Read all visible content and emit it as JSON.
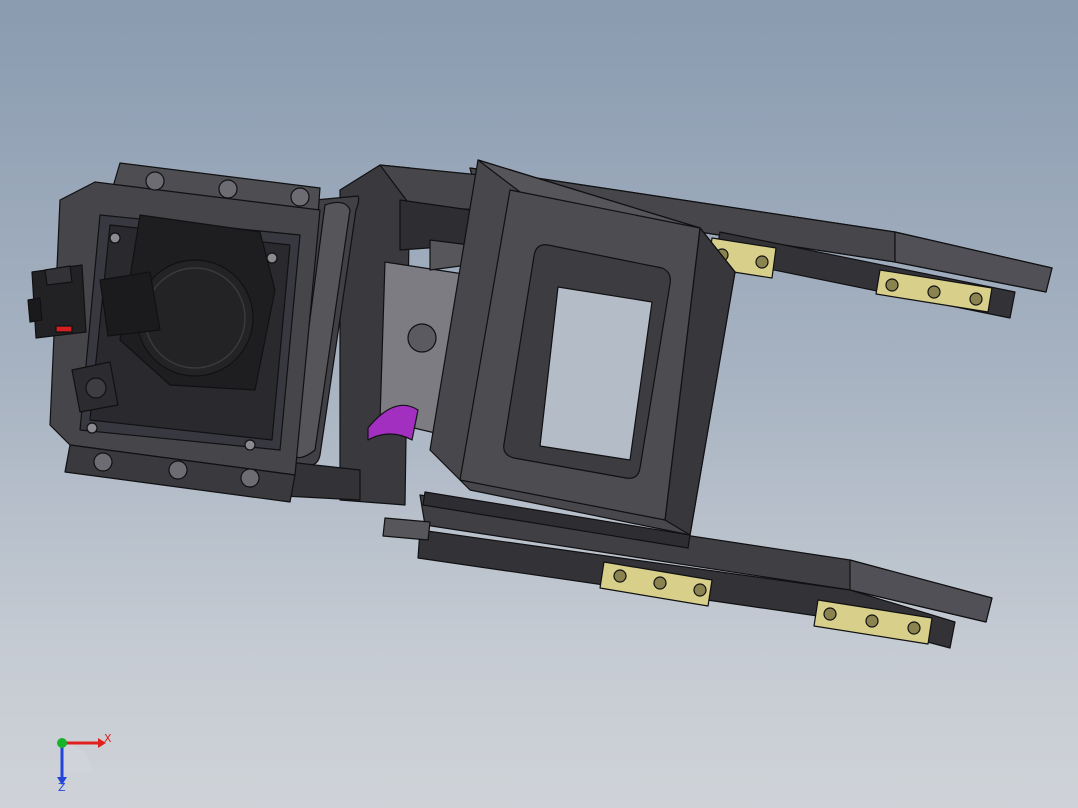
{
  "viewport": {
    "background_top": "#8a9bb0",
    "background_bottom": "#cfd3d8"
  },
  "model": {
    "body_color": "#3d3d41",
    "body_light": "#56565b",
    "body_dark": "#252528",
    "edge_color": "#111113",
    "pad_color": "#d8cf8a",
    "accent_color": "#a22fc0",
    "connector_red": "#d42020"
  },
  "triad": {
    "x_label": "X",
    "z_label": "Z",
    "x_color": "#e0201c",
    "y_color": "#17b42a",
    "z_color": "#2245d8"
  }
}
